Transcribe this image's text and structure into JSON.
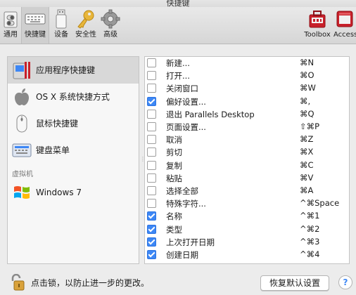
{
  "window": {
    "title": "快捷键"
  },
  "toolbar": {
    "items": [
      {
        "label": "通用",
        "icon": "general-switch-icon"
      },
      {
        "label": "快捷键",
        "icon": "keyboard-icon",
        "active": true
      },
      {
        "label": "设备",
        "icon": "usb-device-icon"
      },
      {
        "label": "安全性",
        "icon": "key-icon"
      },
      {
        "label": "高级",
        "icon": "gear-icon"
      },
      {
        "label": "Toolbox",
        "icon": "toolbox-icon"
      },
      {
        "label": "Access",
        "icon": "access-icon"
      }
    ]
  },
  "sidebar": {
    "items": [
      {
        "label": "应用程序快捷键",
        "icon": "parallels-app-icon",
        "selected": true
      },
      {
        "label": "OS X 系统快捷方式",
        "icon": "apple-icon"
      },
      {
        "label": "鼠标快捷键",
        "icon": "mouse-icon"
      },
      {
        "label": "键盘菜单",
        "icon": "keyboard-menu-icon"
      }
    ],
    "section_label": "虚拟机",
    "vm_items": [
      {
        "label": "Windows 7",
        "icon": "windows-logo-icon"
      }
    ]
  },
  "shortcuts": [
    {
      "name": "新建...",
      "key": "⌘N",
      "checked": false
    },
    {
      "name": "打开...",
      "key": "⌘O",
      "checked": false
    },
    {
      "name": "关闭窗口",
      "key": "⌘W",
      "checked": false
    },
    {
      "name": "偏好设置...",
      "key": "⌘,",
      "checked": true
    },
    {
      "name": "退出 Parallels Desktop",
      "key": "⌘Q",
      "checked": false
    },
    {
      "name": "页面设置...",
      "key": "⇧⌘P",
      "checked": false
    },
    {
      "name": "取消",
      "key": "⌘Z",
      "checked": false
    },
    {
      "name": "剪切",
      "key": "⌘X",
      "checked": false
    },
    {
      "name": "复制",
      "key": "⌘C",
      "checked": false
    },
    {
      "name": "粘贴",
      "key": "⌘V",
      "checked": false
    },
    {
      "name": "选择全部",
      "key": "⌘A",
      "checked": false
    },
    {
      "name": "特殊字符...",
      "key": "^⌘Space",
      "checked": false
    },
    {
      "name": "名称",
      "key": "^⌘1",
      "checked": true
    },
    {
      "name": "类型",
      "key": "^⌘2",
      "checked": true
    },
    {
      "name": "上次打开日期",
      "key": "^⌘3",
      "checked": true
    },
    {
      "name": "创建日期",
      "key": "^⌘4",
      "checked": true
    }
  ],
  "footer": {
    "lock_text": "点击锁，以防止进一步的更改。",
    "restore_label": "恢复默认设置",
    "help_label": "?"
  },
  "colors": {
    "accent": "#3d87f5",
    "toolbox_red": "#c8202a"
  }
}
